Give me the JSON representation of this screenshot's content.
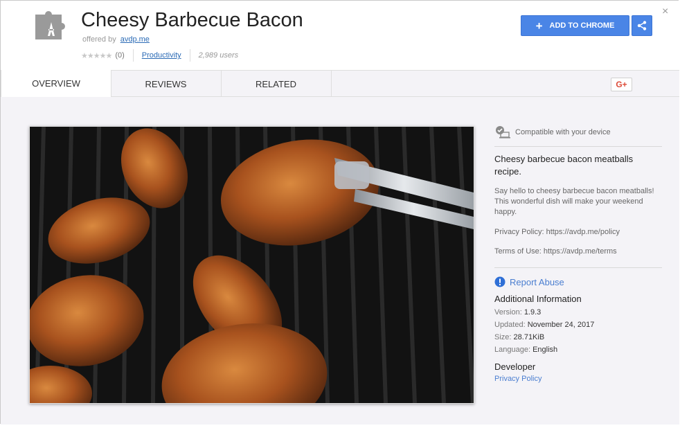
{
  "header": {
    "title": "Cheesy Barbecue Bacon",
    "offered_by_label": "offered by",
    "offered_by_link": "avdp.me",
    "stars": "★★★★★",
    "rating_count": "(0)",
    "rating_value": 0,
    "category": "Productivity",
    "users": "2,989 users",
    "add_button": "ADD TO CHROME",
    "close": "×"
  },
  "tabs": [
    {
      "label": "OVERVIEW",
      "active": true
    },
    {
      "label": "REVIEWS",
      "active": false
    },
    {
      "label": "RELATED",
      "active": false
    }
  ],
  "gplus": "G+",
  "sidebar": {
    "compatible": "Compatible with your device",
    "desc_title": "Cheesy barbecue bacon meatballs recipe.",
    "desc_body": "Say hello to cheesy barbecue bacon meatballs! This wonderful dish will make your weekend happy.",
    "privacy_policy": "Privacy Policy: https://avdp.me/policy",
    "terms": "Terms of Use: https://avdp.me/terms",
    "report_abuse": "Report Abuse",
    "additional_title": "Additional Information",
    "version_label": "Version:",
    "version_value": "1.9.3",
    "updated_label": "Updated:",
    "updated_value": "November 24, 2017",
    "size_label": "Size:",
    "size_value": "28.71KiB",
    "language_label": "Language:",
    "language_value": "English",
    "developer_title": "Developer",
    "developer_link": "Privacy Policy"
  },
  "colors": {
    "accent": "#4a85e6",
    "link": "#4a7ed0",
    "gplus": "#dd4b39",
    "panel_bg": "#f4f3f7"
  },
  "icons": {
    "extension": "puzzle-piece-icon",
    "share": "share-icon",
    "compatible": "device-check-icon",
    "report": "exclamation-circle-icon"
  }
}
